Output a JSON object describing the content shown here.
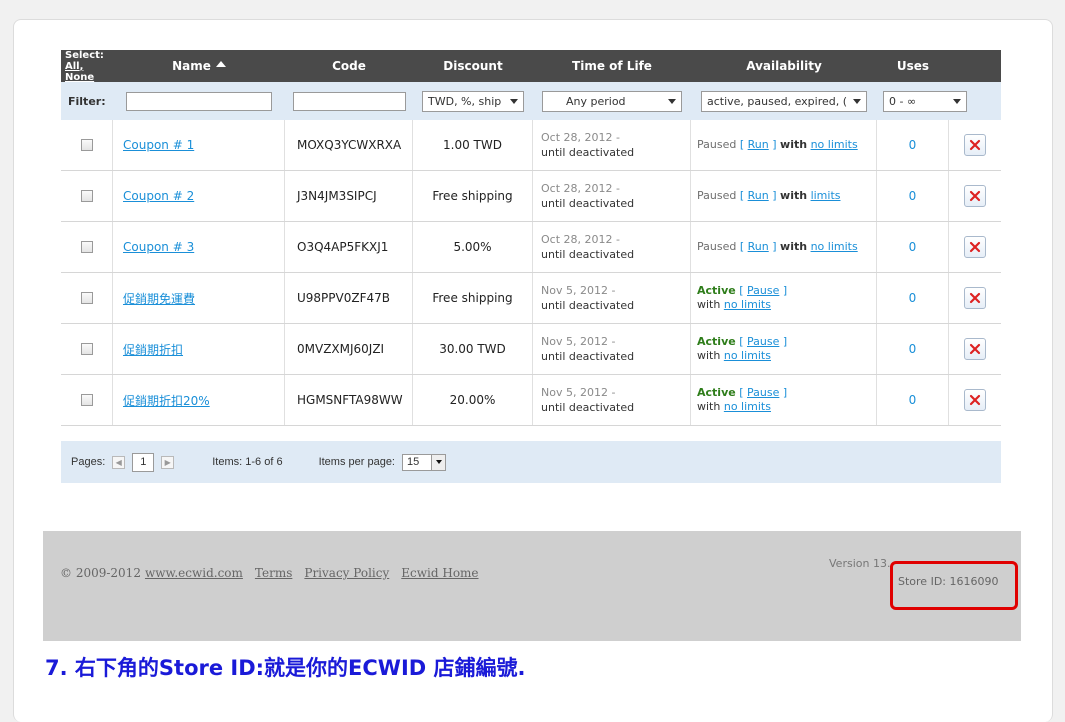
{
  "header": {
    "select_label": "Select:",
    "select_all": "All",
    "select_none": "None",
    "name": "Name",
    "code": "Code",
    "discount": "Discount",
    "time_of_life": "Time of Life",
    "availability": "Availability",
    "uses": "Uses"
  },
  "filter": {
    "label": "Filter:",
    "name_value": "",
    "code_value": "",
    "discount_select": "TWD, %, ship",
    "period_select": "Any period",
    "availability_select": "active, paused, expired, (",
    "uses_select": "0 - ∞"
  },
  "rows": [
    {
      "name": "Coupon # 1",
      "code": "MOXQ3YCWXRXA",
      "discount": "1.00 TWD",
      "date": "Oct 28, 2012 -",
      "until": "until deactivated",
      "status": "Paused",
      "action": "Run",
      "with": "with",
      "limits": "no limits",
      "uses": "0"
    },
    {
      "name": "Coupon # 2",
      "code": "J3N4JM3SIPCJ",
      "discount": "Free shipping",
      "date": "Oct 28, 2012 -",
      "until": "until deactivated",
      "status": "Paused",
      "action": "Run",
      "with": "with",
      "limits": "limits",
      "uses": "0"
    },
    {
      "name": "Coupon # 3",
      "code": "O3Q4AP5FKXJ1",
      "discount": "5.00%",
      "date": "Oct 28, 2012 -",
      "until": "until deactivated",
      "status": "Paused",
      "action": "Run",
      "with": "with",
      "limits": "no limits",
      "uses": "0"
    },
    {
      "name": "促銷期免運費",
      "code": "U98PPV0ZF47B",
      "discount": "Free shipping",
      "date": "Nov 5, 2012 -",
      "until": "until deactivated",
      "status": "Active",
      "action": "Pause",
      "with": "with",
      "limits": "no limits",
      "uses": "0"
    },
    {
      "name": "促銷期折扣",
      "code": "0MVZXMJ60JZI",
      "discount": "30.00 TWD",
      "date": "Nov 5, 2012 -",
      "until": "until deactivated",
      "status": "Active",
      "action": "Pause",
      "with": "with",
      "limits": "no limits",
      "uses": "0"
    },
    {
      "name": "促銷期折扣20%",
      "code": "HGMSNFTA98WW",
      "discount": "20.00%",
      "date": "Nov 5, 2012 -",
      "until": "until deactivated",
      "status": "Active",
      "action": "Pause",
      "with": "with",
      "limits": "no limits",
      "uses": "0"
    }
  ],
  "pager": {
    "pages_label": "Pages:",
    "current_page": "1",
    "items_text": "Items: 1-6 of 6",
    "per_page_label": "Items per page:",
    "per_page_value": "15"
  },
  "footer": {
    "copyright": "© 2009-2012",
    "site_link": "www.ecwid.com",
    "terms": "Terms",
    "privacy": "Privacy Policy",
    "home": "Ecwid Home",
    "version": "Version 13.",
    "store_id": "Store ID: 1616090"
  },
  "note": "7. 右下角的Store ID:就是你的ECWID 店鋪編號.",
  "colors": {
    "header_bg": "#4a4a4a",
    "filter_bg": "#dfeaf5",
    "link": "#1a8fd8",
    "active_green": "#2e7d1a",
    "highlight_red": "#e00000",
    "note_blue": "#1a1ad8"
  }
}
